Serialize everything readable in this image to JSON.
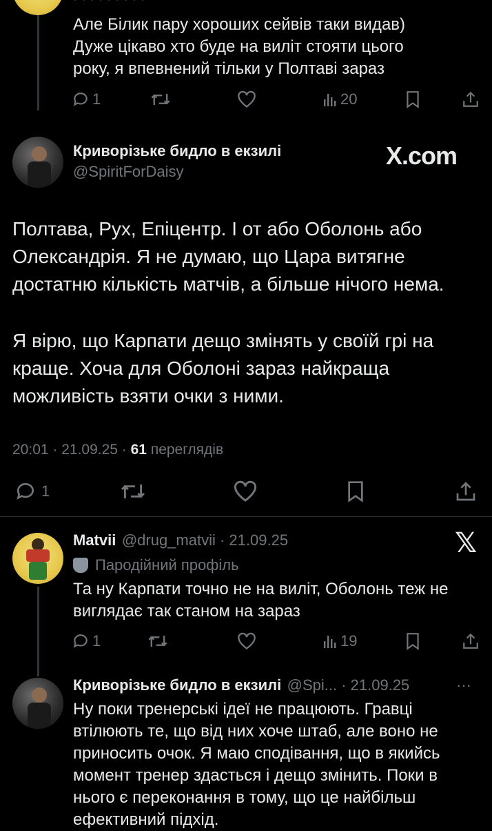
{
  "reply1": {
    "text": "Але Білик пару хороших сейвів таки видав) Дуже цікаво хто буде на виліт стояти цього року, я впевнений тільки у Полтаві зараз",
    "replies": "1",
    "views": "20"
  },
  "main_post": {
    "author_name": "Криворізьке бидло в екзилі",
    "author_handle": "@SpiritForDaisy",
    "watermark": "X.com",
    "paragraph1": "Полтава, Рух, Епіцентр. І от або Оболонь або Олександрія. Я не думаю, що Цара витягне достатню кількість матчів, а більше нічого нема.",
    "paragraph2": "Я вірю, що Карпати дещо змінять у своїй грі на краще. Хоча для Оболоні зараз найкраща можливість взяти очки з ними.",
    "time": "20:01 · 21.09.25 · ",
    "views_count": "61",
    "views_label": " переглядів",
    "replies": "1"
  },
  "reply2": {
    "author_name": "Matvii",
    "author_handle": "@drug_matvii · 21.09.25",
    "parody_label": "Пародійний профіль",
    "text": "Та ну Карпати точно не на виліт, Оболонь теж не виглядає так станом на зараз",
    "replies": "1",
    "views": "19"
  },
  "reply3": {
    "author_name": "Криворізьке бидло в екзилі",
    "author_handle": "@Spi... · 21.09.25",
    "more": "···",
    "text": "Ну поки тренерські ідеї не працюють. Гравці втілюють те, що від них хоче штаб, але воно не приносить очок. Я маю сподівання, що в якийсь момент тренер здасться і дещо змінить. Поки в нього є переконання в тому, що це найбільш ефективний підхід."
  },
  "icons": [
    "reply-icon",
    "retweet-icon",
    "like-icon",
    "views-icon",
    "bookmark-icon",
    "share-icon",
    "x-logo-icon",
    "parody-mask-icon",
    "more-icon"
  ]
}
